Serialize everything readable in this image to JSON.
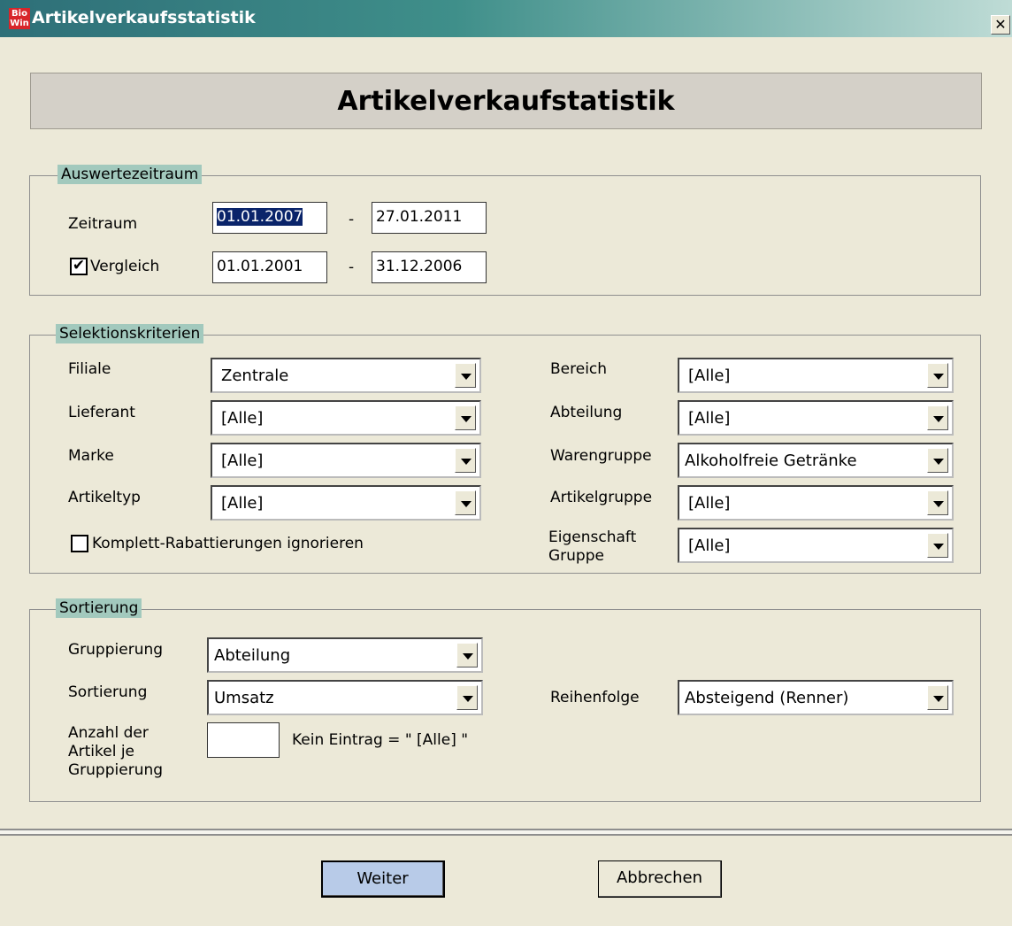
{
  "window": {
    "title": "Artikelverkaufsstatistik",
    "icon_text_top": "Bio",
    "icon_text_bottom": "Win",
    "close_glyph": "✕"
  },
  "header": {
    "banner": "Artikelverkaufstatistik"
  },
  "zeitraum_group": {
    "legend": "Auswertezeitraum",
    "zeitraum_label": "Zeitraum",
    "zeitraum_from": "01.01.2007",
    "zeitraum_to": "27.01.2011",
    "vergleich_label": "Vergleich",
    "vergleich_checked": "✔",
    "vergleich_from": "01.01.2001",
    "vergleich_to": "31.12.2006",
    "dash": "-"
  },
  "selektion": {
    "legend": "Selektionskriterien",
    "filiale_label": "Filiale",
    "filiale_value": "Zentrale",
    "lieferant_label": "Lieferant",
    "lieferant_value": "[Alle]",
    "marke_label": "Marke",
    "marke_value": "[Alle]",
    "artikeltyp_label": "Artikeltyp",
    "artikeltyp_value": "[Alle]",
    "komplett_label": "Komplett-Rabattierungen ignorieren",
    "bereich_label": "Bereich",
    "bereich_value": "[Alle]",
    "abteilung_label": "Abteilung",
    "abteilung_value": "[Alle]",
    "warengruppe_label": "Warengruppe",
    "warengruppe_value": "Alkoholfreie Getränke",
    "artikelgruppe_label": "Artikelgruppe",
    "artikelgruppe_value": "[Alle]",
    "eigenschaft_label_line1": "Eigenschaft",
    "eigenschaft_label_line2": "Gruppe",
    "eigenschaft_value": "[Alle]"
  },
  "sortierung": {
    "legend": "Sortierung",
    "gruppierung_label": "Gruppierung",
    "gruppierung_value": "Abteilung",
    "sortierung_label": "Sortierung",
    "sortierung_value": "Umsatz",
    "reihenfolge_label": "Reihenfolge",
    "reihenfolge_value": "Absteigend (Renner)",
    "anzahl_label_1": "Anzahl der",
    "anzahl_label_2": "Artikel je",
    "anzahl_label_3": "Gruppierung",
    "anzahl_value": "",
    "hint": "Kein Eintrag = \" [Alle] \""
  },
  "buttons": {
    "weiter": "Weiter",
    "abbrechen": "Abbrechen"
  },
  "colors": {
    "title_gradient_start": "#2e6f78",
    "legend_bg": "#a2c9bd",
    "primary_button": "#b8cbe8",
    "selection": "#0a246a"
  }
}
